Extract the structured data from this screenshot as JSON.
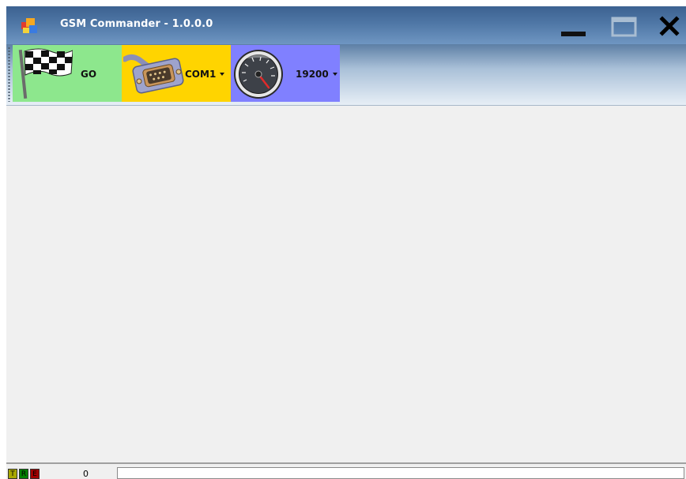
{
  "window": {
    "title": "GSM Commander - 1.0.0.0",
    "icon": "app-windows-icon"
  },
  "controls": {
    "minimize_icon": "minimize-icon",
    "maximize_icon": "maximize-icon",
    "close_icon": "close-icon"
  },
  "toolbar": {
    "go": {
      "label": "GO",
      "icon": "checkered-flag-icon",
      "color": "#8de78d"
    },
    "port": {
      "label": "COM1",
      "icon": "serial-connector-icon",
      "color": "#ffd400"
    },
    "baud": {
      "label": "19200",
      "icon": "speedometer-icon",
      "color": "#8080ff"
    }
  },
  "status": {
    "indicators": [
      {
        "label": "T",
        "color": "#a8a800"
      },
      {
        "label": "R",
        "color": "#008000"
      },
      {
        "label": "E",
        "color": "#a00000"
      }
    ],
    "counter": "0",
    "message": ""
  }
}
